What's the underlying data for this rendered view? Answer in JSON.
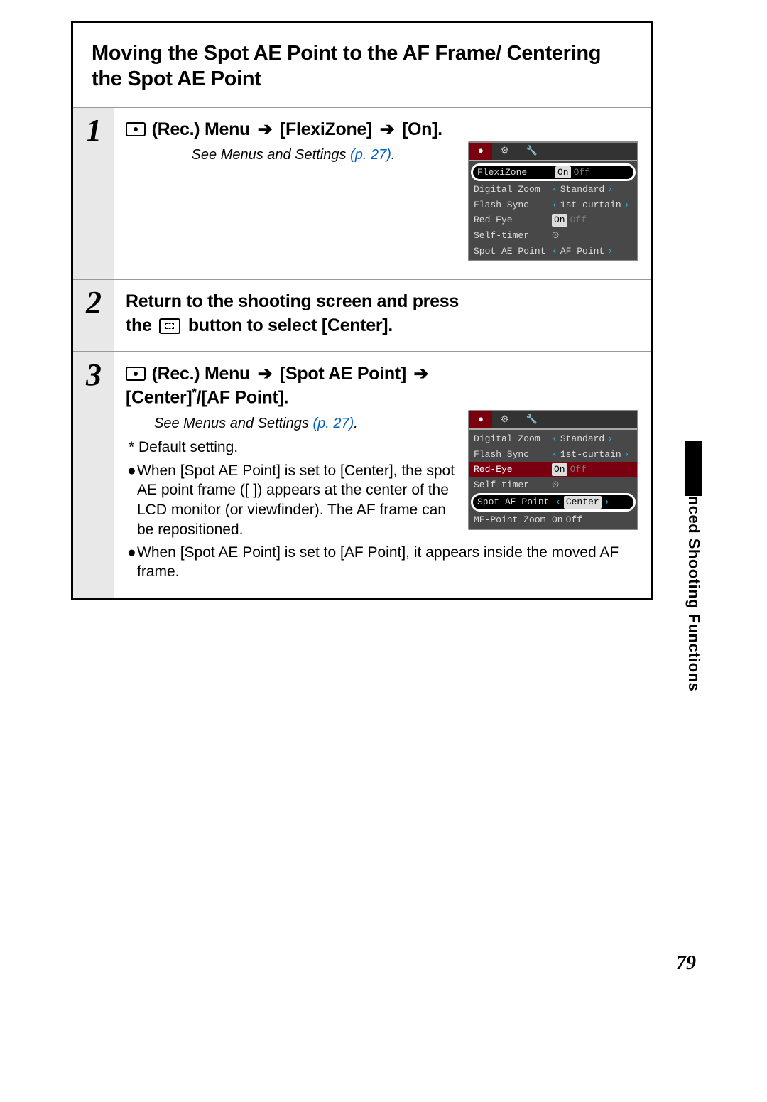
{
  "section_title": "Moving the Spot AE Point to the AF Frame/ Centering the Spot AE Point",
  "side_tab": "Advanced Shooting Functions",
  "page_number": "79",
  "steps": [
    {
      "num": "1",
      "head_prefix": "(Rec.) Menu",
      "head_path": [
        "[FlexiZone]",
        "[On]."
      ],
      "sub_note_prefix": "See Menus and Settings ",
      "sub_note_link": "(p. 27)",
      "sub_note_suffix": "."
    },
    {
      "num": "2",
      "head_line1": "Return to the shooting screen and press",
      "head_line2a": "the ",
      "head_line2b": " button to select [Center]."
    },
    {
      "num": "3",
      "head_prefix": "(Rec.) Menu",
      "head_path1": "[Spot AE Point]",
      "head_path2": "[Center]",
      "head_star": "*",
      "head_path3": "/[AF Point].",
      "sub_note_prefix": "See Menus and Settings ",
      "sub_note_link": "(p. 27)",
      "sub_note_suffix": ".",
      "default_note": "* Default setting.",
      "bullets": [
        "When [Spot AE Point] is set to [Center], the spot AE point frame ([  ]) appears at the center of the LCD monitor (or viewfinder). The AF frame can be repositioned.",
        "When [Spot AE Point] is set to [AF Point], it appears inside the moved AF frame."
      ]
    }
  ],
  "menu1": {
    "tabs": [
      "●",
      "⚙",
      "🔧"
    ],
    "rows": [
      {
        "label": "FlexiZone",
        "val_sel": "On",
        "val_dim": "Off",
        "hl": true
      },
      {
        "label": "Digital Zoom",
        "val": "Standard",
        "dim": true,
        "arrows": true
      },
      {
        "label": "Flash Sync",
        "val": "1st-curtain",
        "arrows": true
      },
      {
        "label": "Red-Eye",
        "val_sel": "On",
        "val_dim": "Off"
      },
      {
        "label": "Self-timer",
        "val": "⏲"
      },
      {
        "label": "Spot AE Point",
        "val": "AF Point",
        "arrows": true
      }
    ]
  },
  "menu2": {
    "tabs": [
      "●",
      "⚙",
      "🔧"
    ],
    "rows": [
      {
        "label": "Digital Zoom",
        "val": "Standard",
        "arrows": true
      },
      {
        "label": "Flash Sync",
        "val": "1st-curtain",
        "arrows": true
      },
      {
        "label": "Red-Eye",
        "val_sel": "On",
        "val_dim": "Off",
        "red": true
      },
      {
        "label": "Self-timer",
        "val": "⏲",
        "dim": true
      },
      {
        "label": "Spot AE Point",
        "val_box": "Center",
        "hl": true,
        "arrows": true
      },
      {
        "label": "MF-Point Zoom",
        "val_sel": "On",
        "val_dim": "Off",
        "dim": true
      }
    ]
  }
}
